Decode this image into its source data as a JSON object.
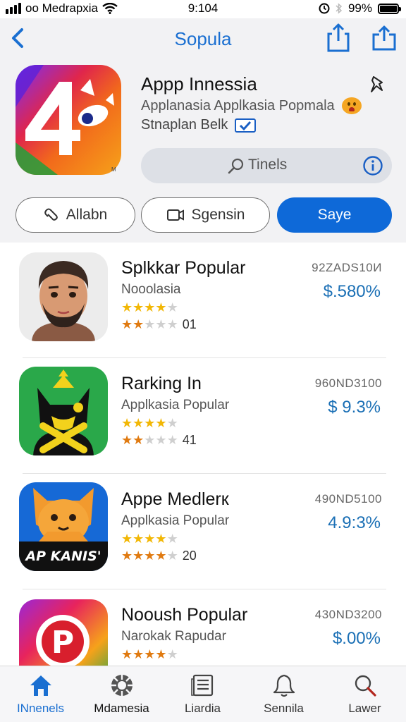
{
  "status_bar": {
    "carrier": "oo Medrapxia",
    "time": "9:104",
    "battery": "99%",
    "battery_level": 0.99
  },
  "nav": {
    "title": "Sopula"
  },
  "app": {
    "title": "Appp Innessia",
    "subtitle": "Applanasia Applkasia Popmala",
    "seller": "Stnaplan Belk",
    "search_label": "Tinels",
    "icon_text": "4",
    "icon_mark": "M",
    "colors": {
      "accent": "#0e69d8",
      "title_blue": "#1a6fd1"
    }
  },
  "actions": {
    "allabn": "Allabn",
    "sgensin": "Sgensin",
    "saye": "Saye"
  },
  "list": [
    {
      "name": "Splkkar Popular",
      "category": "Nooolasia",
      "code": "92ZADS10И",
      "price": "$.580%",
      "rating_count": "01",
      "rating_a": 4,
      "rating_b": 2,
      "icon": "avatar-face"
    },
    {
      "name": "Rarking In",
      "category": "Applkasia Popular",
      "code": "960ND3100",
      "price": "$ 9.3%",
      "rating_count": "41",
      "rating_a": 4,
      "rating_b": 2,
      "icon": "cat-mascot"
    },
    {
      "name": "Appe Medlerк",
      "category": "Applkasia Popular",
      "code": "490ND5100",
      "price": "4.9:3%",
      "rating_count": "20",
      "rating_a": 4,
      "rating_b": 4,
      "icon_text": "AP KANIS'",
      "icon": "dog-mascot"
    },
    {
      "name": "Nooush Popular",
      "category": "Narokak  Rapudar",
      "code": "430ND3200",
      "price": "$.00%",
      "rating_count": "",
      "rating_a": 4,
      "rating_b": 0,
      "icon_text": "P",
      "icon": "p-logo"
    }
  ],
  "tabs": [
    {
      "label": "INnenels",
      "icon": "home-icon"
    },
    {
      "label": "Mdamesia",
      "icon": "globe-icon"
    },
    {
      "label": "Liardia",
      "icon": "list-icon"
    },
    {
      "label": "Sennila",
      "icon": "bell-icon"
    },
    {
      "label": "Lawer",
      "icon": "search-icon"
    }
  ]
}
